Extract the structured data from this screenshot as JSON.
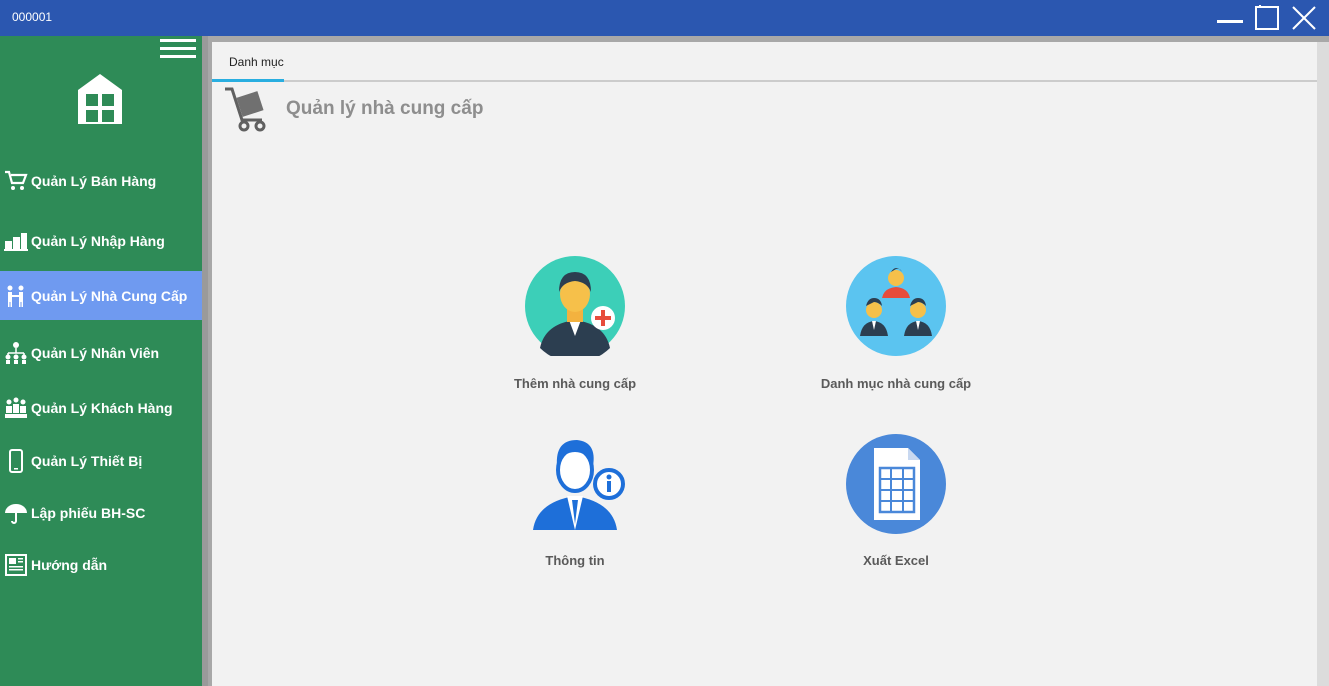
{
  "window": {
    "title": "000001"
  },
  "sidebar": {
    "items": [
      {
        "label": "Quản Lý Bán Hàng"
      },
      {
        "label": "Quản Lý Nhập Hàng"
      },
      {
        "label": "Quản Lý Nhà Cung Cấp"
      },
      {
        "label": "Quản Lý Nhân Viên"
      },
      {
        "label": "Quản Lý Khách Hàng"
      },
      {
        "label": "Quản Lý Thiết Bị"
      },
      {
        "label": "Lập phiếu BH-SC"
      },
      {
        "label": "Hướng dẫn"
      }
    ],
    "active_index": 2
  },
  "tabs": [
    {
      "label": "Danh mục"
    }
  ],
  "page": {
    "title": "Quản lý nhà cung cấp"
  },
  "tiles": [
    {
      "label": "Thêm nhà cung cấp",
      "icon": "add-supplier-icon"
    },
    {
      "label": "Danh mục nhà cung cấp",
      "icon": "supplier-list-icon"
    },
    {
      "label": "Thông tin",
      "icon": "info-user-icon"
    },
    {
      "label": "Xuất Excel",
      "icon": "excel-sheet-icon"
    }
  ],
  "colors": {
    "titlebar": "#2b57b0",
    "sidebar": "#2e8b57",
    "active_item": "#6f9af0",
    "tab_underline": "#29aee0"
  }
}
